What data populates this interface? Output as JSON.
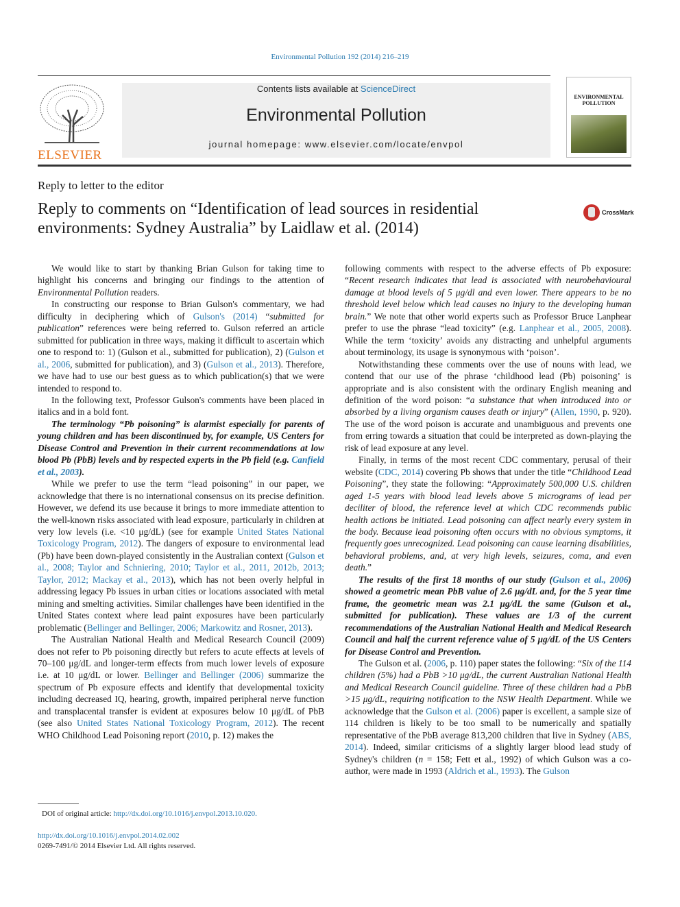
{
  "header": {
    "citation": "Environmental Pollution 192 (2014) 216–219",
    "contents_prefix": "Contents lists available at ",
    "contents_link": "ScienceDirect",
    "journal_title": "Environmental Pollution",
    "homepage_prefix": "journal homepage: ",
    "homepage_url": "www.elsevier.com/locate/envpol",
    "publisher_logo": "ELSEVIER",
    "cover_title": "ENVIRONMENTAL POLLUTION"
  },
  "article": {
    "type": "Reply to letter to the editor",
    "title": "Reply to comments on “Identification of lead sources in residential environments: Sydney Australia” by Laidlaw et al. (2014)",
    "crossmark": "CrossMark"
  },
  "colors": {
    "link": "#2a7ab0",
    "elsevier_orange": "#e8731d",
    "banner_bg": "#efefef"
  },
  "body_left": [
    {
      "cont": false,
      "segs": [
        [
          "",
          "We would like to start by thanking Brian Gulson for taking time to highlight his concerns and bringing our findings to the attention of "
        ],
        [
          "i",
          "Environmental Pollution"
        ],
        [
          "",
          " readers."
        ]
      ]
    },
    {
      "cont": false,
      "segs": [
        [
          "",
          "In constructing our response to Brian Gulson's commentary, we had difficulty in deciphering which of "
        ],
        [
          "l",
          "Gulson's (2014)"
        ],
        [
          "",
          " “"
        ],
        [
          "i",
          "submitted for publication"
        ],
        [
          "",
          "” references were being referred to. Gulson referred an article submitted for publication in three ways, making it difficult to ascertain which one to respond to: 1) (Gulson et al., submitted for publication), 2) ("
        ],
        [
          "l",
          "Gulson et al., 2006"
        ],
        [
          "",
          ", submitted for publication), and 3) ("
        ],
        [
          "l",
          "Gulson et al., 2013"
        ],
        [
          "",
          "). Therefore, we have had to use our best guess as to which publication(s) that we were intended to respond to."
        ]
      ]
    },
    {
      "cont": false,
      "segs": [
        [
          "",
          "In the following text, Professor Gulson's comments have been placed in italics and in a bold font."
        ]
      ]
    },
    {
      "cont": false,
      "segs": [
        [
          "b",
          "The terminology “Pb poisoning” is alarmist especially for parents of young children and has been discontinued by, for example, US Centers for Disease Control and Prevention in their current recommendations at low blood Pb (PbB) levels and by respected experts in the Pb field (e.g. "
        ],
        [
          "bl",
          "Canfield et al., 2003"
        ],
        [
          "b",
          ")."
        ]
      ]
    },
    {
      "cont": false,
      "segs": [
        [
          "",
          "While we prefer to use the term “lead poisoning” in our paper, we acknowledge that there is no international consensus on its precise definition. However, we defend its use because it brings to more immediate attention to the well-known risks associated with lead exposure, particularly in children at very low levels (i.e. <10 μg/dL) (see for example "
        ],
        [
          "l",
          "United States National Toxicology Program, 2012"
        ],
        [
          "",
          "). The dangers of exposure to environmental lead (Pb) have been down-played consistently in the Australian context ("
        ],
        [
          "l",
          "Gulson et al., 2008; Taylor and Schniering, 2010; Taylor et al., 2011, 2012b, 2013; Taylor, 2012; Mackay et al., 2013"
        ],
        [
          "",
          "), which has not been overly helpful in addressing legacy Pb issues in urban cities or locations associated with metal mining and smelting activities. Similar challenges have been identified in the United States context where lead paint exposures have been particularly problematic ("
        ],
        [
          "l",
          "Bellinger and Bellinger, 2006; Markowitz and Rosner, 2013"
        ],
        [
          "",
          ")."
        ]
      ]
    },
    {
      "cont": false,
      "segs": [
        [
          "",
          "The Australian National Health and Medical Research Council (2009) does not refer to Pb poisoning directly but refers to acute effects at levels of 70–100 μg/dL and longer-term effects from much lower levels of exposure i.e. at 10 μg/dL or lower. "
        ],
        [
          "l",
          "Bellinger and Bellinger (2006)"
        ],
        [
          "",
          " summarize the spectrum of Pb exposure effects and identify that developmental toxicity including decreased IQ, hearing, growth, impaired peripheral nerve function and transplacental transfer is evident at exposures below 10 μg/dL of PbB (see also "
        ],
        [
          "l",
          "United States National Toxicology Program, 2012"
        ],
        [
          "",
          "). The recent WHO Childhood Lead Poisoning report ("
        ],
        [
          "l",
          "2010"
        ],
        [
          "",
          ", p. 12) makes the"
        ]
      ]
    }
  ],
  "body_right": [
    {
      "cont": true,
      "segs": [
        [
          "",
          "following comments with respect to the adverse effects of Pb exposure: “"
        ],
        [
          "i",
          "Recent research indicates that lead is associated with neurobehavioural damage at blood levels of 5 μg/dl and even lower. There appears to be no threshold level below which lead causes no injury to the developing human brain."
        ],
        [
          "",
          "” We note that other world experts such as Professor Bruce Lanphear prefer to use the phrase “lead toxicity” (e.g. "
        ],
        [
          "l",
          "Lanphear et al., 2005, 2008"
        ],
        [
          "",
          "). While the term ‘toxicity’ avoids any distracting and unhelpful arguments about terminology, its usage is synonymous with ‘poison’."
        ]
      ]
    },
    {
      "cont": false,
      "segs": [
        [
          "",
          "Notwithstanding these comments over the use of nouns with lead, we contend that our use of the phrase ‘childhood lead (Pb) poisoning’ is appropriate and is also consistent with the ordinary English meaning and definition of the word poison: “"
        ],
        [
          "i",
          "a substance that when introduced into or absorbed by a living organism causes death or injury"
        ],
        [
          "",
          "” ("
        ],
        [
          "l",
          "Allen, 1990"
        ],
        [
          "",
          ", p. 920). The use of the word poison is accurate and unambiguous and prevents one from erring towards a situation that could be interpreted as down-playing the risk of lead exposure at any level."
        ]
      ]
    },
    {
      "cont": false,
      "segs": [
        [
          "",
          "Finally, in terms of the most recent CDC commentary, perusal of their website ("
        ],
        [
          "l",
          "CDC, 2014"
        ],
        [
          "",
          ") covering Pb shows that under the title “"
        ],
        [
          "i",
          "Childhood Lead Poisoning"
        ],
        [
          "",
          "”, they state the following: “"
        ],
        [
          "i",
          "Approximately 500,000 U.S. children aged 1-5 years with blood lead levels above 5 micrograms of lead per deciliter of blood, the reference level at which CDC recommends public health actions be initiated. Lead poisoning can affect nearly every system in the body. Because lead poisoning often occurs with no obvious symptoms, it frequently goes unrecognized. Lead poisoning can cause learning disabilities, behavioral problems, and, at very high levels, seizures, coma, and even death."
        ],
        [
          "",
          "”"
        ]
      ]
    },
    {
      "cont": false,
      "segs": [
        [
          "b",
          "The results of the first 18 months of our study ("
        ],
        [
          "bl",
          "Gulson et al., 2006"
        ],
        [
          "b",
          ") showed a geometric mean PbB value of 2.6 μg/dL and, for the 5 year time frame, the geometric mean was 2.1 μg/dL the same (Gulson et al., submitted for publication). These values are 1/3 of the current recommendations of the Australian National Health and Medical Research Council and half the current reference value of 5 μg/dL of the US Centers for Disease Control and Prevention."
        ]
      ]
    },
    {
      "cont": false,
      "segs": [
        [
          "",
          "The Gulson et al. ("
        ],
        [
          "l",
          "2006"
        ],
        [
          "",
          ", p. 110) paper states the following: “"
        ],
        [
          "i",
          "Six of the 114 children (5%) had a PbB >10 μg/dL, the current Australian National Health and Medical Research Council guideline. Three of these children had a PbB >15 μg/dL, requiring notification to the NSW Health Department"
        ],
        [
          "",
          ". While we acknowledge that the "
        ],
        [
          "l",
          "Gulson et al. (2006)"
        ],
        [
          "",
          " paper is excellent, a sample size of 114 children is likely to be too small to be numerically and spatially representative of the PbB average 813,200 children that live in Sydney ("
        ],
        [
          "l",
          "ABS, 2014"
        ],
        [
          "",
          "). Indeed, similar criticisms of a slightly larger blood lead study of Sydney's children ("
        ],
        [
          "i",
          "n"
        ],
        [
          "",
          " = 158; Fett et al., 1992) of which Gulson was a co-author, were made in 1993 ("
        ],
        [
          "l",
          "Aldrich et al., 1993"
        ],
        [
          "",
          "). The "
        ],
        [
          "l",
          "Gulson"
        ]
      ]
    }
  ],
  "footnote": {
    "prefix": "DOI of original article: ",
    "doi": "http://dx.doi.org/10.1016/j.envpol.2013.10.020."
  },
  "footer": {
    "doi": "http://dx.doi.org/10.1016/j.envpol.2014.02.002",
    "copyright": "0269-7491/© 2014 Elsevier Ltd. All rights reserved."
  }
}
